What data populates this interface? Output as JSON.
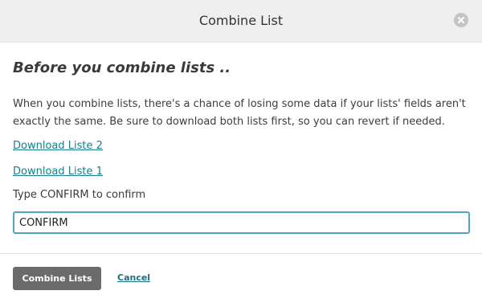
{
  "dialog": {
    "title": "Combine List"
  },
  "content": {
    "heading": "Before you combine lists ..",
    "description": "When you combine lists, there's a chance of losing some data if your lists' fields aren't exactly the same. Be sure to download both lists first, so you can revert if needed.",
    "download_link_1": "Download Liste 2",
    "download_link_2": "Download Liste 1",
    "confirm_label": "Type CONFIRM to confirm",
    "confirm_value": "CONFIRM"
  },
  "footer": {
    "primary_label": "Combine Lists",
    "cancel_label": "Cancel"
  },
  "icons": {
    "close": "close-icon"
  },
  "colors": {
    "header_bg": "#efefef",
    "link": "#1a7b8c",
    "input_border": "#4fa7b8",
    "primary_button": "#6b6b6b"
  }
}
